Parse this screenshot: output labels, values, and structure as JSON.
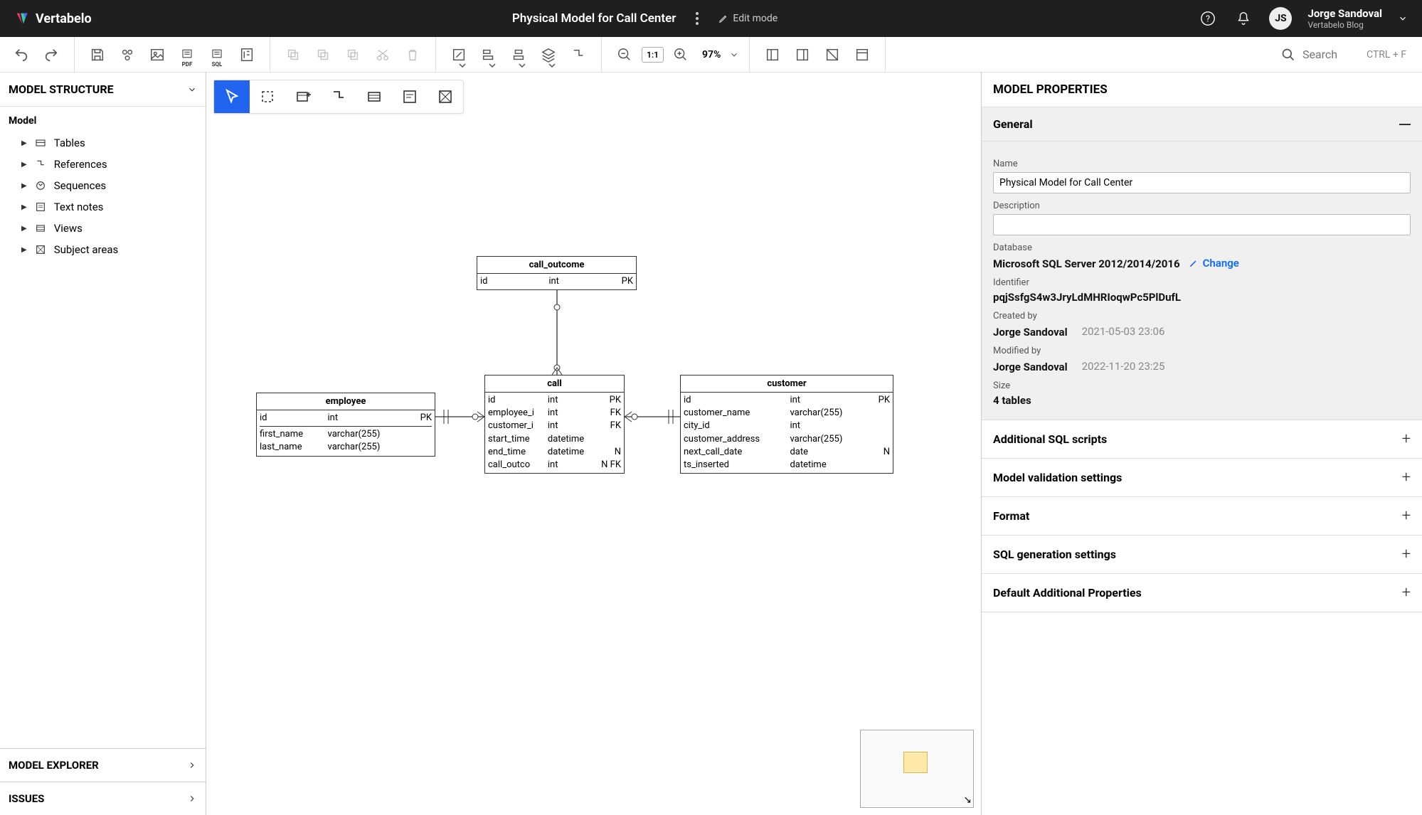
{
  "brand": "Vertabelo",
  "header": {
    "title": "Physical Model for Call Center",
    "edit_mode": "Edit mode",
    "user_initials": "JS",
    "user_name": "Jorge Sandoval",
    "user_sub": "Vertabelo Blog"
  },
  "toolbar": {
    "zoom_ratio": "1:1",
    "zoom_value": "97%",
    "search_placeholder": "Search",
    "search_hint": "CTRL + F",
    "pdf_label": "PDF",
    "sql_label": "SQL"
  },
  "left_panel": {
    "title": "MODEL STRUCTURE",
    "root": "Model",
    "tree": [
      {
        "label": "Tables"
      },
      {
        "label": "References"
      },
      {
        "label": "Sequences"
      },
      {
        "label": "Text notes"
      },
      {
        "label": "Views"
      },
      {
        "label": "Subject areas"
      }
    ],
    "explorer": "MODEL EXPLORER",
    "issues": "ISSUES"
  },
  "entities": {
    "call_outcome": {
      "name": "call_outcome",
      "rows": [
        {
          "name": "id",
          "type": "int",
          "key": "PK"
        }
      ]
    },
    "call": {
      "name": "call",
      "rows": [
        {
          "name": "id",
          "type": "int",
          "key": "PK"
        },
        {
          "name": "employee_i",
          "type": "int",
          "key": "FK"
        },
        {
          "name": "customer_i",
          "type": "int",
          "key": "FK"
        },
        {
          "name": "start_time",
          "type": "datetime",
          "key": ""
        },
        {
          "name": "end_time",
          "type": "datetime",
          "key": "N"
        },
        {
          "name": "call_outco",
          "type": "int",
          "key": "N FK"
        }
      ]
    },
    "employee": {
      "name": "employee",
      "rows_pk": [
        {
          "name": "id",
          "type": "int",
          "key": "PK"
        }
      ],
      "rows": [
        {
          "name": "first_name",
          "type": "varchar(255)",
          "key": ""
        },
        {
          "name": "last_name",
          "type": "varchar(255)",
          "key": ""
        }
      ]
    },
    "customer": {
      "name": "customer",
      "rows": [
        {
          "name": "id",
          "type": "int",
          "key": "PK"
        },
        {
          "name": "customer_name",
          "type": "varchar(255)",
          "key": ""
        },
        {
          "name": "city_id",
          "type": "int",
          "key": ""
        },
        {
          "name": "customer_address",
          "type": "varchar(255)",
          "key": ""
        },
        {
          "name": "next_call_date",
          "type": "date",
          "key": "N"
        },
        {
          "name": "ts_inserted",
          "type": "datetime",
          "key": ""
        }
      ]
    }
  },
  "properties": {
    "title": "MODEL PROPERTIES",
    "general": "General",
    "name_label": "Name",
    "name_value": "Physical Model for Call Center",
    "description_label": "Description",
    "description_value": "",
    "database_label": "Database",
    "database_value": "Microsoft SQL Server 2012/2014/2016",
    "change": "Change",
    "identifier_label": "Identifier",
    "identifier_value": "pqjSsfgS4w3JryLdMHRIoqwPc5PlDufL",
    "created_label": "Created by",
    "created_by": "Jorge Sandoval",
    "created_at": "2021-05-03 23:06",
    "modified_label": "Modified by",
    "modified_by": "Jorge Sandoval",
    "modified_at": "2022-11-20 23:25",
    "size_label": "Size",
    "size_value": "4 tables",
    "sections": [
      "Additional SQL scripts",
      "Model validation settings",
      "Format",
      "SQL generation settings",
      "Default Additional Properties"
    ]
  }
}
